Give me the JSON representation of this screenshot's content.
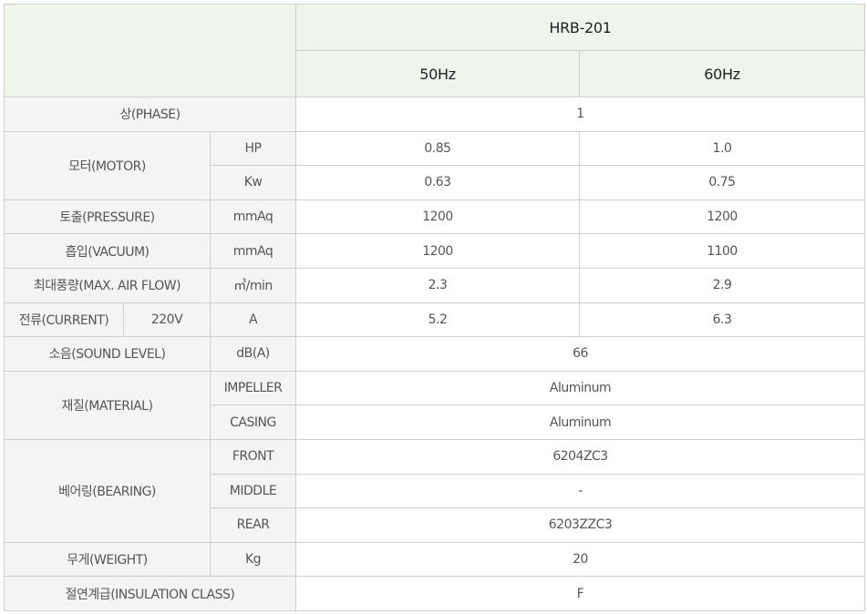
{
  "header": {
    "model": "HRB-201",
    "freq_50": "50Hz",
    "freq_60": "60Hz"
  },
  "rows": {
    "phase": {
      "label": "상(PHASE)",
      "value": "1"
    },
    "motor": {
      "label": "모터(MOTOR)",
      "hp": {
        "unit": "HP",
        "v50": "0.85",
        "v60": "1.0"
      },
      "kw": {
        "unit": "Kw",
        "v50": "0.63",
        "v60": "0.75"
      }
    },
    "pressure": {
      "label": "토출(PRESSURE)",
      "unit": "mmAq",
      "v50": "1200",
      "v60": "1200"
    },
    "vacuum": {
      "label": "흡입(VACUUM)",
      "unit": "mmAq",
      "v50": "1200",
      "v60": "1100"
    },
    "airflow": {
      "label": "최대풍량(MAX. AIR FLOW)",
      "unit": "㎥/min",
      "v50": "2.3",
      "v60": "2.9"
    },
    "current": {
      "label": "전류(CURRENT)",
      "voltage": "220V",
      "unit": "A",
      "v50": "5.2",
      "v60": "6.3"
    },
    "sound": {
      "label": "소음(SOUND LEVEL)",
      "unit": "dB(A)",
      "value": "66"
    },
    "material": {
      "label": "재질(MATERIAL)",
      "impeller": {
        "unit": "IMPELLER",
        "value": "Aluminum"
      },
      "casing": {
        "unit": "CASING",
        "value": "Aluminum"
      }
    },
    "bearing": {
      "label": "베어링(BEARING)",
      "front": {
        "unit": "FRONT",
        "value": "6204ZC3"
      },
      "middle": {
        "unit": "MIDDLE",
        "value": "-"
      },
      "rear": {
        "unit": "REAR",
        "value": "6203ZZC3"
      }
    },
    "weight": {
      "label": "무게(WEIGHT)",
      "unit": "Kg",
      "value": "20"
    },
    "insulation": {
      "label": "절연계급(INSULATION CLASS)",
      "value": "F"
    }
  }
}
